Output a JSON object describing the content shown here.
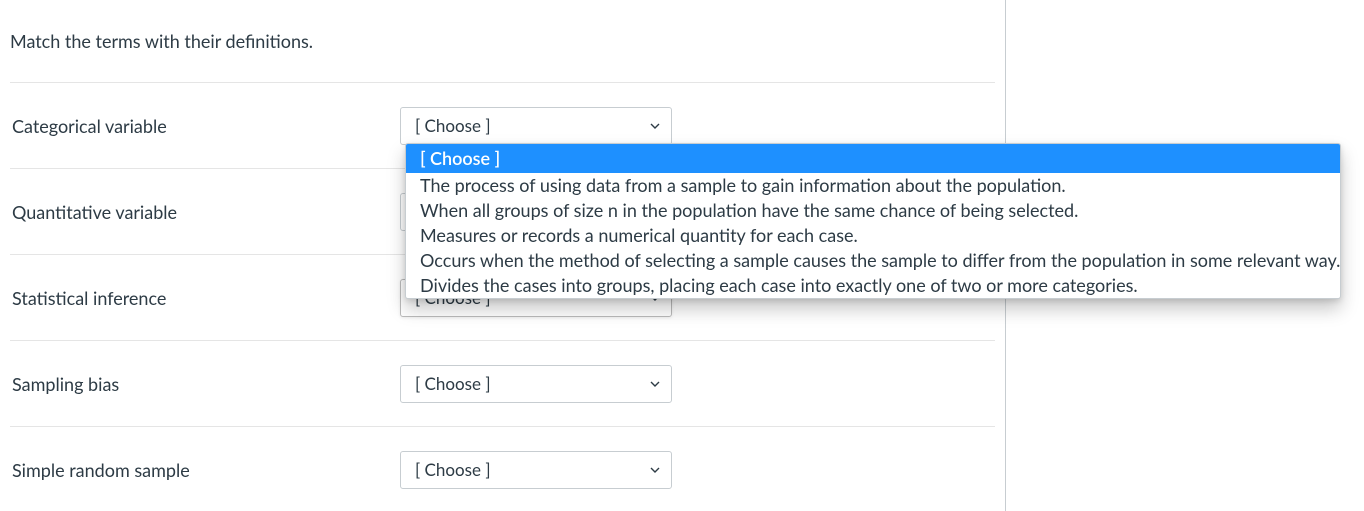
{
  "prompt": "Match the terms with their definitions.",
  "choose_placeholder": "[ Choose ]",
  "terms": {
    "0": {
      "label": "Categorical variable",
      "selected": "[ Choose ]"
    },
    "1": {
      "label": "Quantitative variable",
      "selected": "[ Choose ]"
    },
    "2": {
      "label": "Statistical inference",
      "selected": "[ Choose ]"
    },
    "3": {
      "label": "Sampling bias",
      "selected": "[ Choose ]"
    },
    "4": {
      "label": "Simple random sample",
      "selected": "[ Choose ]"
    }
  },
  "dropdown": {
    "options": {
      "0": "[ Choose ]",
      "1": "The process of using data from a sample to gain information about the population.",
      "2": "When all groups of size n in the population have the same chance of being selected.",
      "3": "Measures or records a numerical quantity for each case.",
      "4": "Occurs when the method of selecting a sample causes the sample to differ from the population in some relevant way.",
      "5": "Divides the cases into groups, placing each case into exactly one of two or more categories."
    }
  }
}
